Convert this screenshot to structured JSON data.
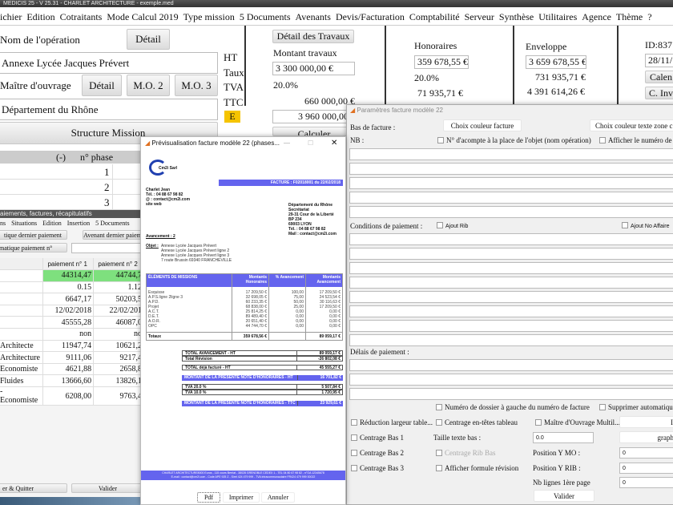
{
  "app": {
    "title": "MEDICIS 25 - V 25.31 - CHARLET ARCHITECTURE - exemple.med",
    "menu": [
      "ichier",
      "Edition",
      "Cotraitants",
      "Mode Calcul 2019",
      "Type mission",
      "5 Documents",
      "Avenants",
      "Devis/Facturation",
      "Comptabilité",
      "Serveur",
      "Synthèse",
      "Utilitaires",
      "Agence",
      "Thème",
      "?"
    ]
  },
  "operation": {
    "label": "Nom de l'opération",
    "detail": "Détail",
    "value": "Annexe Lycée Jacques Prévert"
  },
  "owner": {
    "label": "Maître d'ouvrage",
    "detail": "Détail",
    "mo2": "M.O. 2",
    "mo3": "M.O. 3",
    "value": "Département du Rhône"
  },
  "structure_btn": "Structure Mission",
  "tax_labels": {
    "ht": "HT",
    "taux": "Taux",
    "tva": "TVA",
    "ttc": "TTC",
    "e": "E"
  },
  "travaux": {
    "detail_btn": "Détail des Travaux",
    "label": "Montant travaux",
    "ht": "3 300 000,00 €",
    "rate": "20.0%",
    "tva": "660 000,00 €",
    "ttc": "3 960 000,00 €",
    "calc_btn": "Calculer"
  },
  "honoraires": {
    "label": "Honoraires",
    "ht": "359 678,55 €",
    "rate": "20.0%",
    "tva": "71 935,71 €"
  },
  "enveloppe": {
    "label": "Enveloppe",
    "ht": "3 659 678,55 €",
    "tva": "731 935,71 €",
    "ttc": "4 391 614,26 €"
  },
  "idbox": {
    "id": "ID:837",
    "date": "28/11/",
    "cal_btn": "Calen",
    "inv_btn": "C. Inv"
  },
  "phases": {
    "minus": "(-)",
    "header": "n° phase",
    "rows": [
      "1",
      "2",
      "3"
    ]
  },
  "payments": {
    "title": "aiements, factures, récapitulatifs",
    "menu": [
      "ns",
      "Situations",
      "Edition",
      "Insertion",
      "5 Documents"
    ],
    "btn_last": "tique dernier paiement",
    "btn_avenant": "Avenant dernier paiem",
    "btn_auto": "matique paiement n°",
    "headers": [
      "paiement n° 1",
      "paiement n° 2"
    ],
    "rows": [
      [
        "",
        "44314,47",
        "44744,7"
      ],
      [
        "",
        "0.15",
        "1.12"
      ],
      [
        "",
        "6647,17",
        "50203,5"
      ],
      [
        "",
        "12/02/2018",
        "22/02/201"
      ],
      [
        "",
        "45555,28",
        "46087,0"
      ],
      [
        "",
        "non",
        "no"
      ],
      [
        "Architecte",
        "11947,74",
        "10621,2"
      ],
      [
        "Architecture",
        "9111,06",
        "9217,4"
      ],
      [
        "Economiste",
        "4621,88",
        "2658,8"
      ],
      [
        "Fluides",
        "13666,60",
        "13826,1"
      ],
      [
        "- Economiste",
        "6208,00",
        "9763,4"
      ]
    ],
    "highlight": "#7ee07e",
    "btn_quit": "er & Quitter",
    "btn_validate": "Valider"
  },
  "preview": {
    "title": "Prévisualisation facture modèle 22 (phases...",
    "logo": "Cm2i Sarl",
    "invoice_no": "FACTURE : F02018001 du 22/02/2018",
    "sender": [
      "Charlet Jean",
      "Tél. : 04 88 67 98 82",
      "@ : contact@cm2i.com",
      "site web"
    ],
    "recipient": [
      "Département du Rhône",
      "Secrétariat",
      "29-31 Cour de la Liberté",
      "BP 234",
      "69003 LYON",
      "Tél. : 04 88 67 98 82",
      "Mail : contact@cm2i.com"
    ],
    "avancement": "Avancement : 2",
    "objet_label": "Objet :",
    "objet": [
      "Annexe Lycée Jacques Prévert",
      "Annexe Lycée Jacques Prévert ligne 2",
      "Annexe Lycée Jacques Prévert ligne 3",
      "7 route Brussin 69340 FRANCHEVILLE"
    ],
    "table_headers": [
      "ÉLÉMENTS DE MISSIONS",
      "Montants Honoraires",
      "% Avancement",
      "Montants Avancement"
    ],
    "table_rows": [
      [
        "Esquisse",
        "17 209,50 €",
        "100,00",
        "17 209,50 €"
      ],
      [
        "A.P.S.ligne 2ligne 3",
        "32 698,05 €",
        "75,00",
        "24 523,54 €"
      ],
      [
        "A.P.D.",
        "60 233,35 €",
        "50,00",
        "30 116,63 €"
      ],
      [
        "Projet",
        "68 838,00 €",
        "25,00",
        "17 209,50 €"
      ],
      [
        "A.C.T.",
        "25 814,25 €",
        "0,00",
        "0,00 €"
      ],
      [
        "D.E.T.",
        "89 489,40 €",
        "0,00",
        "0,00 €"
      ],
      [
        "A.O.R.",
        "20 651,40 €",
        "0,00",
        "0,00 €"
      ],
      [
        "OPC",
        "44 744,70 €",
        "0,00",
        "0,00 €"
      ]
    ],
    "totals": [
      "Totaux",
      "359 678,56 €",
      "",
      "89 059,17 €"
    ],
    "summary": [
      [
        "TOTAL AVANCEMENT - HT",
        "89 059,17 €"
      ],
      [
        "Total Révision",
        "-26 802,08 €"
      ],
      [
        "TOTAL déjà facturé - HT",
        "45 555,27 €"
      ],
      [
        "MONTANT DE LA PRÉSENTE NOTE D'HONORAIRES - HT",
        "16 701,82 €"
      ],
      [
        "TVA 20.0 %",
        "5 507,84 €"
      ],
      [
        "TVA 10.0 %",
        "1 720,95 €"
      ],
      [
        "MONTANT DE LA PRÉSENTE NOTE D'HONORAIRES - TTC",
        "23 929,61 €"
      ]
    ],
    "footer": [
      "CHARLET ARCHITECTURE8000 Euros - 115 cours Berriat - 38028 GRENOBLE CEDEX 1 - TEL 04 80 67 98 82 - n°OA 12345678",
      "E-mail : contact@cm2i.com - Code APE 925 Z - Siret 424 479 999 - TVA intracommunautaire FR424 479 999 00022"
    ],
    "accent": "#6464ee",
    "btn_pdf": "Pdf",
    "btn_print": "Imprimer",
    "btn_cancel": "Annuler"
  },
  "params": {
    "title": "Paramètres facture modèle 22",
    "bas_label": "Bas de facture :",
    "color_btn": "Choix couleur facture",
    "text_color_btn": "Choix couleur texte zone c",
    "nb_label": "NB :",
    "cb_acompte": "N° d'acompte à la place de l'objet (nom opération)",
    "cb_numero": "Afficher le numéro de S",
    "cond_label": "Conditions de paiement :",
    "cb_rib": "Ajout Rib",
    "cb_affaire": "Ajout No Affaire",
    "delais_label": "Délais de paiement :",
    "cb_dossier": "Numéro de dossier à gauche du numéro de facture",
    "cb_supprimer": "Supprimer automatique",
    "cb_reduction": "Réduction largeur table...",
    "cb_centrage_entetes": "Centrage en-têtes tableau",
    "cb_mo_multi": "Maître d'Ouvrage Multil...",
    "btn_ins": "Ins",
    "cb_bas1": "Centrage Bas 1",
    "taille_label": "Taille texte bas :",
    "taille_value": "0.0",
    "btn_graph": "graphiq",
    "cb_bas2": "Centrage Bas 2",
    "cb_rib_bas": "Centrage Rib Bas",
    "pos_mo_label": "Position Y MO :",
    "pos_mo_value": "0",
    "cb_bas3": "Centrage Bas 3",
    "cb_formule": "Afficher formule révision",
    "pos_rib_label": "Position Y RIB :",
    "pos_rib_value": "0",
    "nb_lignes_label": "Nb lignes 1ère page",
    "nb_lignes_value": "0",
    "btn_validate": "Valider"
  }
}
